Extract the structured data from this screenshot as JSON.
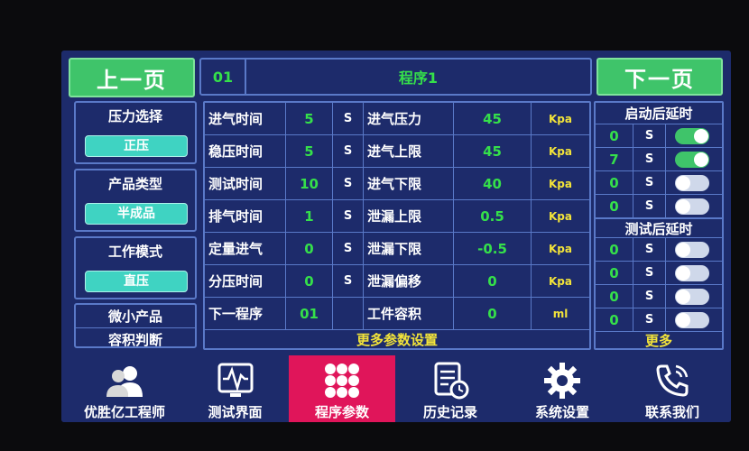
{
  "header": {
    "prev_label": "上一页",
    "next_label": "下一页",
    "program_no": "01",
    "program_name": "程序1"
  },
  "left": {
    "pressure_title": "压力选择",
    "pressure_value": "正压",
    "product_title": "产品类型",
    "product_value": "半成品",
    "mode_title": "工作模式",
    "mode_value": "直压",
    "micro_line1": "微小产品",
    "micro_line2": "容积判断"
  },
  "params": {
    "rows": [
      {
        "l1": "进气时间",
        "v1": "5",
        "u1": "S",
        "l2": "进气压力",
        "v2": "45",
        "u2": "Kpa"
      },
      {
        "l1": "稳压时间",
        "v1": "5",
        "u1": "S",
        "l2": "进气上限",
        "v2": "45",
        "u2": "Kpa"
      },
      {
        "l1": "测试时间",
        "v1": "10",
        "u1": "S",
        "l2": "进气下限",
        "v2": "40",
        "u2": "Kpa"
      },
      {
        "l1": "排气时间",
        "v1": "1",
        "u1": "S",
        "l2": "泄漏上限",
        "v2": "0.5",
        "u2": "Kpa"
      },
      {
        "l1": "定量进气",
        "v1": "0",
        "u1": "S",
        "l2": "泄漏下限",
        "v2": "-0.5",
        "u2": "Kpa"
      },
      {
        "l1": "分压时间",
        "v1": "0",
        "u1": "S",
        "l2": "泄漏偏移",
        "v2": "0",
        "u2": "Kpa"
      },
      {
        "l1": "下一程序",
        "v1": "01",
        "u1": "",
        "l2": "工件容积",
        "v2": "0",
        "u2": "ml"
      }
    ],
    "more_label": "更多参数设置"
  },
  "right": {
    "start_title": "启动后延时",
    "start_rows": [
      {
        "value": "0",
        "unit": "S",
        "on": true
      },
      {
        "value": "7",
        "unit": "S",
        "on": true
      },
      {
        "value": "0",
        "unit": "S",
        "on": false
      },
      {
        "value": "0",
        "unit": "S",
        "on": false
      }
    ],
    "test_title": "测试后延时",
    "test_rows": [
      {
        "value": "0",
        "unit": "S",
        "on": false
      },
      {
        "value": "0",
        "unit": "S",
        "on": false
      },
      {
        "value": "0",
        "unit": "S",
        "on": false
      },
      {
        "value": "0",
        "unit": "S",
        "on": false
      }
    ],
    "more_label": "更多"
  },
  "tabs": [
    {
      "label": "优胜亿工程师",
      "icon": "users-icon"
    },
    {
      "label": "测试界面",
      "icon": "waveform-monitor-icon"
    },
    {
      "label": "程序参数",
      "icon": "grid-dots-icon",
      "active": true
    },
    {
      "label": "历史记录",
      "icon": "history-document-icon"
    },
    {
      "label": "系统设置",
      "icon": "gear-icon"
    },
    {
      "label": "联系我们",
      "icon": "phone-icon"
    }
  ],
  "colors": {
    "background": "#1d2b6b",
    "nav_button": "#3fc46a",
    "value_green": "#35e04a",
    "unit_yellow": "#f2e33a",
    "pill_cyan": "#3fd3c2",
    "active_tab": "#e0155a",
    "toggle_on": "#3fc46a",
    "toggle_off": "#cfd8ea"
  }
}
